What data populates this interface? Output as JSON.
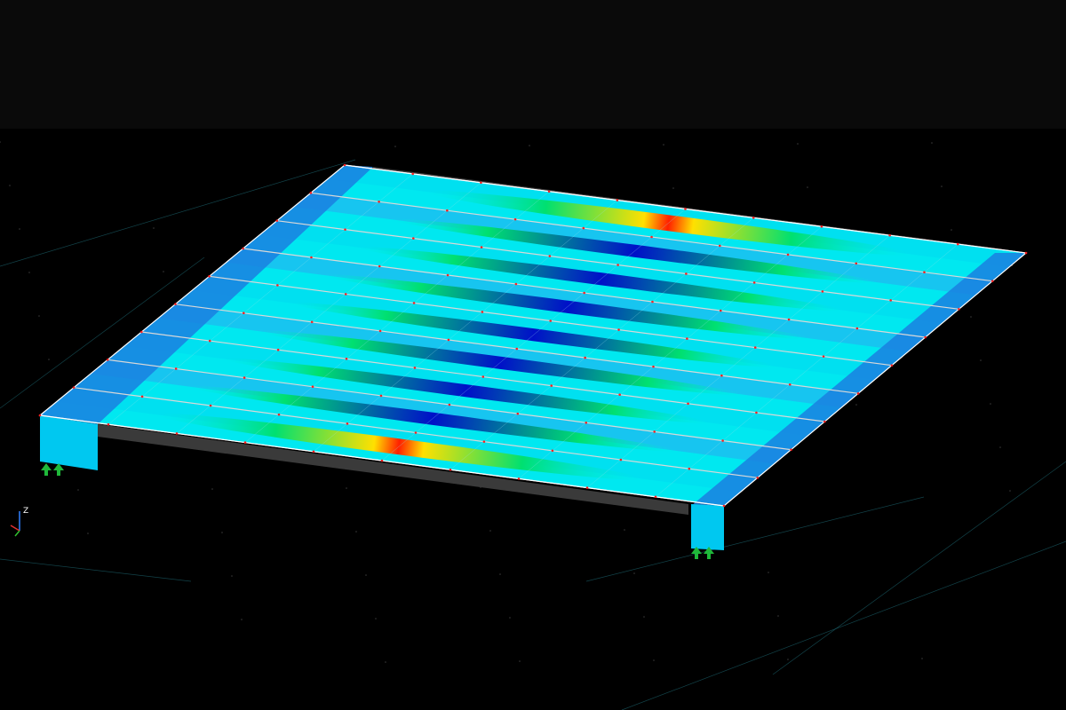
{
  "view": {
    "background": "#000000",
    "top_band": "#0a0a0a",
    "grid_dot_color": "#2a2a2a",
    "grid_line_color": "#1f6f7a"
  },
  "model": {
    "element_type": "folded-plate-deck",
    "rib_count": 9,
    "contour_palette": [
      "#0000c8",
      "#3a8cff",
      "#00d8ff",
      "#00e070",
      "#c8e000",
      "#ffe000",
      "#ff8000",
      "#ff0000"
    ],
    "base_fill": "#00e8f0",
    "edge_color": "#d8d8d8",
    "node_color": "#ff2020",
    "side_wall_color": "#3a3a3a"
  },
  "supports": {
    "count": 2,
    "icon": "support-arrow-icon",
    "color": "#1fb83a"
  },
  "axis_triad": {
    "z_label": "Z",
    "x_color": "#e03030",
    "y_color": "#30c030",
    "z_color": "#3080ff"
  }
}
